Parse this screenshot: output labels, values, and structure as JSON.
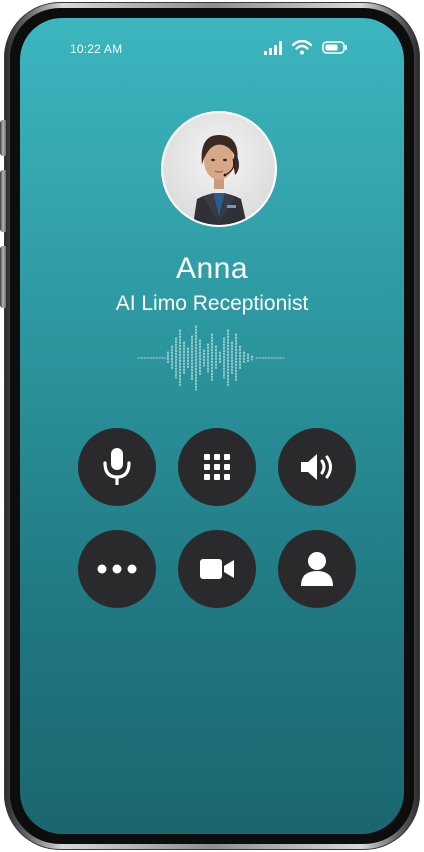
{
  "status_bar": {
    "time": "10:22 AM",
    "signal_icon": "cellular-signal-icon",
    "wifi_icon": "wifi-icon",
    "battery_icon": "battery-icon"
  },
  "caller": {
    "name": "Anna",
    "role": "AI Limo Receptionist",
    "avatar_icon": "receptionist-avatar"
  },
  "controls": [
    {
      "id": "mute",
      "icon": "microphone-icon"
    },
    {
      "id": "keypad",
      "icon": "keypad-icon"
    },
    {
      "id": "speaker",
      "icon": "speaker-icon"
    },
    {
      "id": "more",
      "icon": "more-icon"
    },
    {
      "id": "video",
      "icon": "video-camera-icon"
    },
    {
      "id": "contacts",
      "icon": "contact-person-icon"
    }
  ],
  "colors": {
    "screen_top": "#3cb6bf",
    "screen_bottom": "#1b6670",
    "button_bg": "#2a2a2c",
    "text": "#ffffff"
  }
}
